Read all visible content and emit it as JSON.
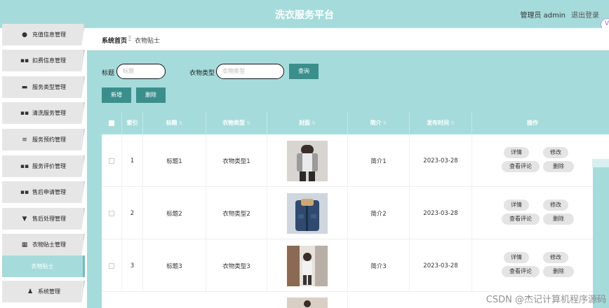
{
  "header": {
    "title": "洗衣服务平台",
    "user": "管理员 admin",
    "logout": "退出登录"
  },
  "sidebar": {
    "items": [
      {
        "label": "充值信息管理",
        "icon": "location-pin-icon"
      },
      {
        "label": "扣费信息管理",
        "icon": "grid-icon"
      },
      {
        "label": "服务类型管理",
        "icon": "monitor-icon"
      },
      {
        "label": "清洗服务管理",
        "icon": "grid-icon"
      },
      {
        "label": "服务预约管理",
        "icon": "sliders-icon"
      },
      {
        "label": "服务评价管理",
        "icon": "grid-icon"
      },
      {
        "label": "售后申请管理",
        "icon": "grid-icon"
      },
      {
        "label": "售后处理管理",
        "icon": "signpost-icon"
      },
      {
        "label": "衣物贴士管理",
        "icon": "grid-dense-icon"
      },
      {
        "label": "衣物贴士",
        "icon": "",
        "sub": true
      },
      {
        "label": "系统管理",
        "icon": "person-icon"
      }
    ]
  },
  "breadcrumb": {
    "home": "系统首页",
    "sep": "Ξ",
    "current": "衣物贴士"
  },
  "search": {
    "title_label": "标题",
    "title_placeholder": "标题",
    "type_label": "衣物类型",
    "type_placeholder": "衣物类型",
    "query_button": "查询"
  },
  "actions": {
    "add": "新增",
    "delete": "删除"
  },
  "table": {
    "headers": [
      "索引",
      "标题",
      "衣物类型",
      "封面",
      "简介",
      "发布时间",
      "操作"
    ],
    "rows": [
      {
        "index": "1",
        "title": "标题1",
        "type": "衣物类型1",
        "intro": "简介1",
        "date": "2023-03-28"
      },
      {
        "index": "2",
        "title": "标题2",
        "type": "衣物类型2",
        "intro": "简介2",
        "date": "2023-03-28"
      },
      {
        "index": "3",
        "title": "标题3",
        "type": "衣物类型3",
        "intro": "简介3",
        "date": "2023-03-28"
      }
    ],
    "row_ops": {
      "detail": "详情",
      "edit": "修改",
      "comments": "查看评论",
      "delete": "删除"
    }
  },
  "watermark": "CSDN @杰记计算机程序源码",
  "colors": {
    "theme": "#a6dbdb",
    "button": "#3a8f8c"
  }
}
